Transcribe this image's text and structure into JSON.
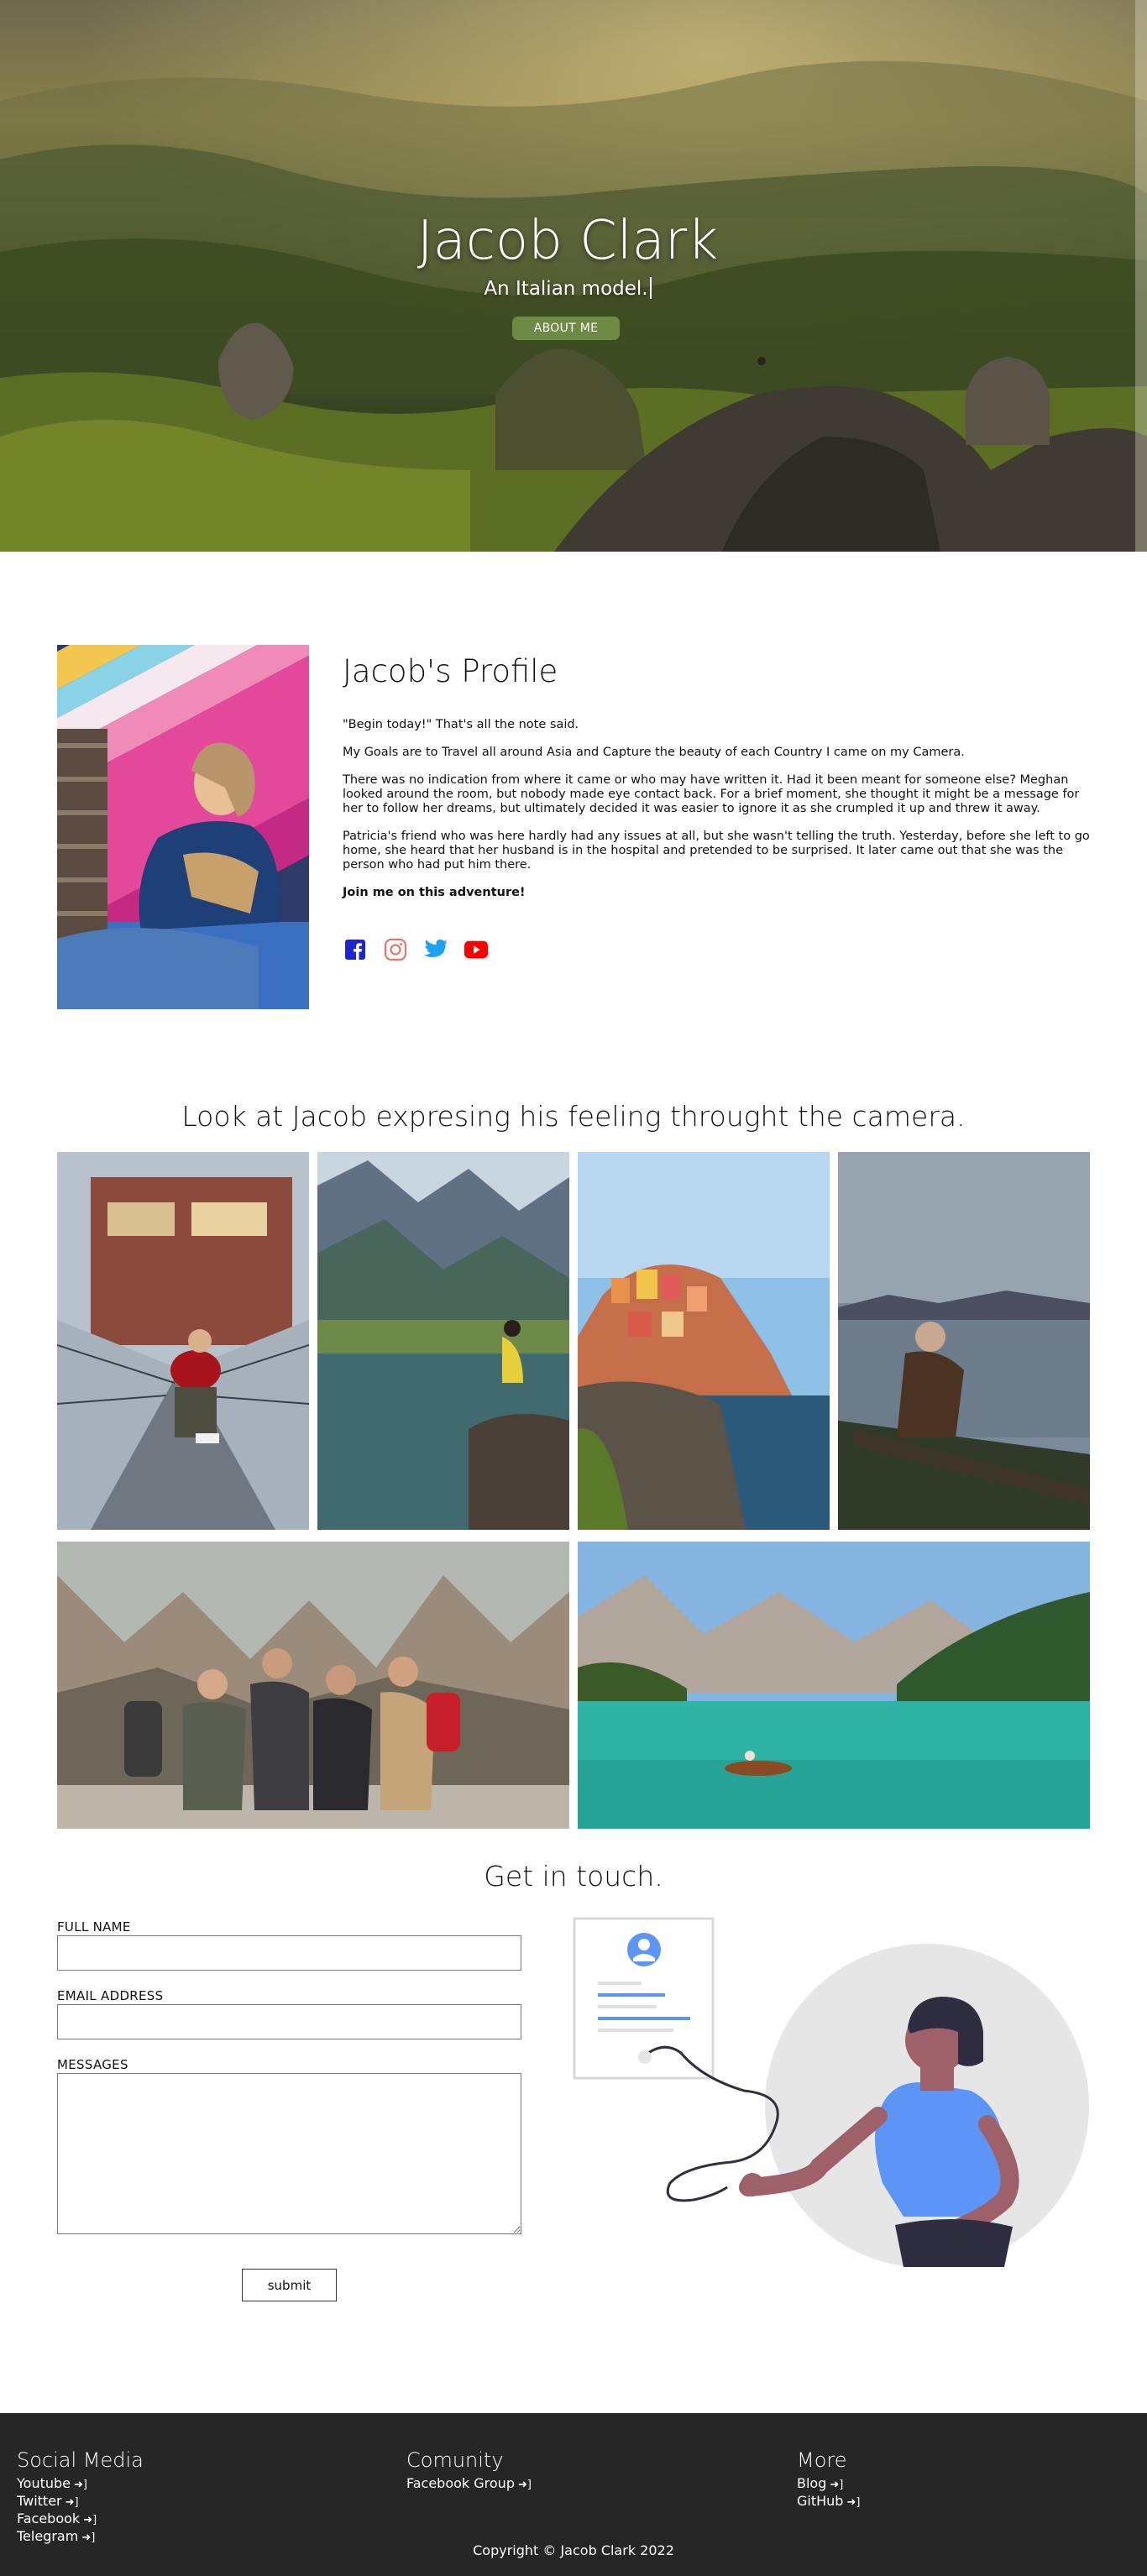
{
  "hero": {
    "title": "Jacob Clark",
    "subtitle": "An  Italian model.",
    "button_label": "ABOUT ME"
  },
  "profile": {
    "heading": "Jacob's Profile",
    "paragraphs": [
      "\"Begin today!\" That's all the note said.",
      "My Goals are to Travel all around Asia and Capture the beauty of each Country I came on my Camera.",
      "There was no indication from where it came or who may have written it. Had it been meant for someone else? Meghan looked around the room, but nobody made eye contact back. For a brief moment, she thought it might be a message for her to follow her dreams, but ultimately decided it was easier to ignore it as she crumpled it up and threw it away.",
      "Patricia's friend who was here hardly had any issues at all, but she wasn't telling the truth. Yesterday, before she left to go home, she heard that her husband is in the hospital and pretended to be surprised. It later came out that she was the person who had put him there."
    ],
    "cta": "Join me on this adventure!",
    "social_icons": [
      "facebook-icon",
      "instagram-icon",
      "twitter-icon",
      "youtube-icon"
    ]
  },
  "gallery": {
    "heading": "Look at Jacob expresing his feeling throught the camera."
  },
  "contact": {
    "heading": "Get in touch.",
    "name_label": "FULL NAME",
    "email_label": "EMAIL ADDRESS",
    "message_label": "MESSAGES",
    "submit_label": "submit"
  },
  "footer": {
    "social": {
      "heading": "Social Media",
      "links": [
        "Youtube",
        "Twitter",
        "Facebook",
        "Telegram"
      ]
    },
    "community": {
      "heading": "Comunity",
      "links": [
        "Facebook Group"
      ]
    },
    "more": {
      "heading": "More",
      "links": [
        "Blog",
        "GitHub"
      ]
    },
    "copyright": "Copyright © Jacob Clark 2022"
  },
  "colors": {
    "button_green": "#6e8a45",
    "footer_bg": "#262626",
    "illus_blue": "#5c95f5"
  }
}
